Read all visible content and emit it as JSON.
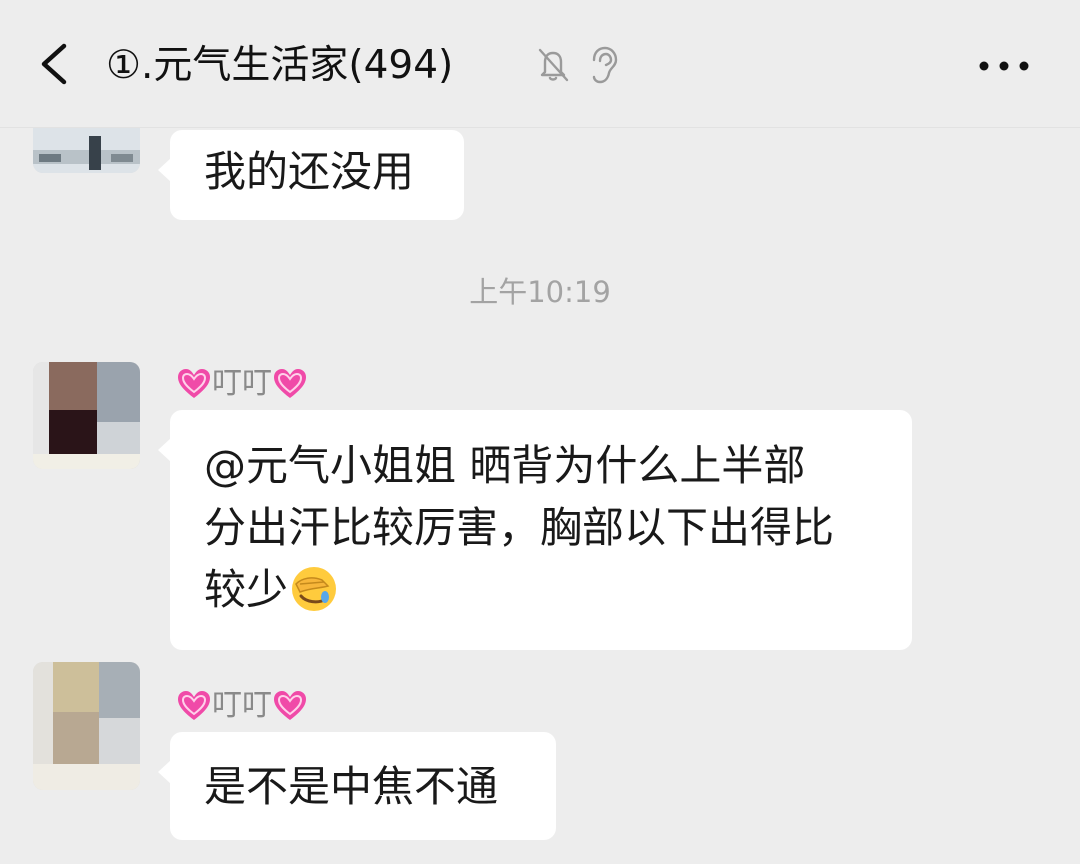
{
  "header": {
    "title": "①.元气生活家(494)",
    "icons": [
      "back-arrow-icon",
      "bell-muted-icon",
      "ear-icon",
      "more-dots-icon"
    ]
  },
  "messages": [
    {
      "text": "我的还没用"
    },
    {
      "text": "@元气小姐姐  晒背为什么上半部",
      "line2": "分出汗比较厉害，胸部以下出得比",
      "line3": "较少",
      "emoji": "facepalm-emoji"
    },
    {
      "text": "是不是中焦不通"
    }
  ],
  "timestamp": "上午10:19",
  "sender": {
    "name": "叮叮"
  },
  "colors": {
    "background": "#ededed",
    "bubble": "#ffffff",
    "heart": "#f04aa8",
    "meta_text": "#8a8a8a"
  }
}
